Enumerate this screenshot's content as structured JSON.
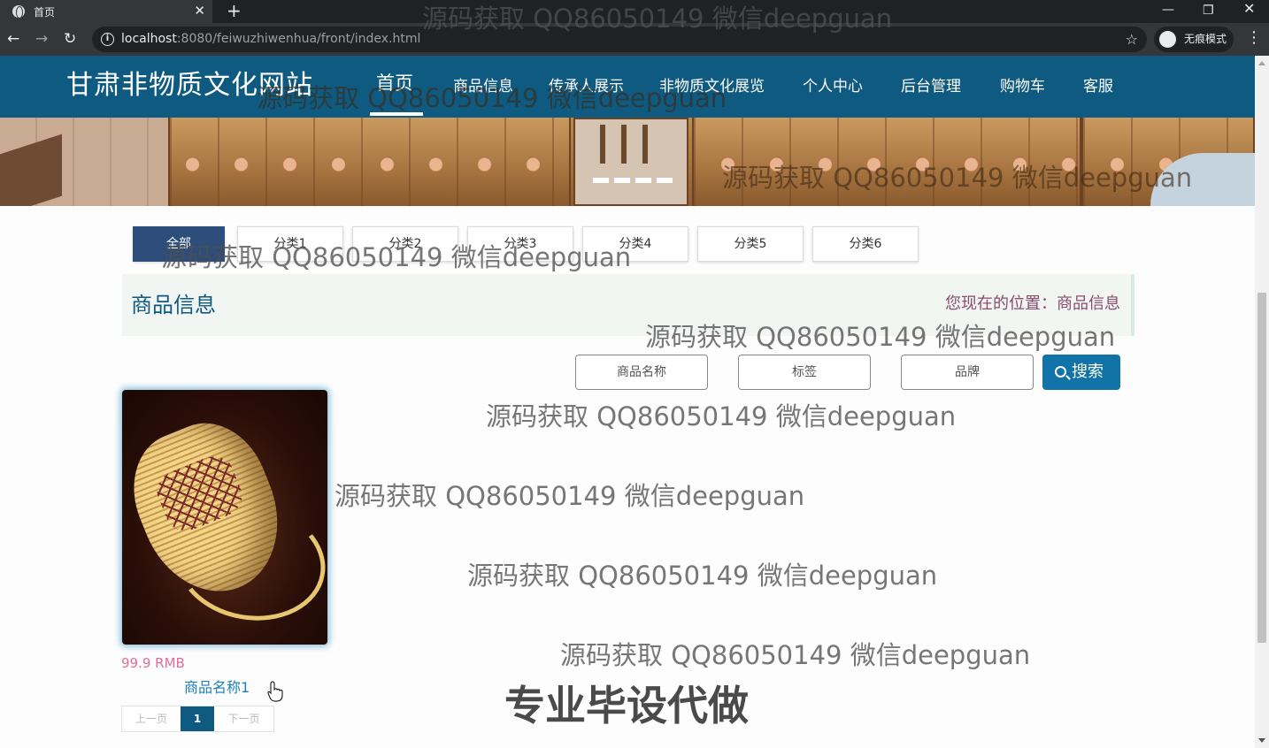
{
  "browser": {
    "tab_title": "首页",
    "tab_close": "✕",
    "new_tab": "+",
    "url_host": "localhost",
    "url_path": ":8080/feiwuzhiwenhua/front/index.html",
    "incognito_label": "无痕模式",
    "window_min": "—",
    "window_restore": "❐",
    "window_close": "✕",
    "back": "←",
    "forward": "→",
    "reload": "↻",
    "star": "☆",
    "menu": "⋮",
    "info": "i"
  },
  "site": {
    "title": "甘肃非物质文化网站",
    "nav": [
      "首页",
      "商品信息",
      "传承人展示",
      "非物质文化展览",
      "个人中心",
      "后台管理",
      "购物车",
      "客服"
    ],
    "active_nav": "首页"
  },
  "categories": [
    "全部",
    "分类1",
    "分类2",
    "分类3",
    "分类4",
    "分类5",
    "分类6"
  ],
  "breadcrumb": {
    "title": "商品信息",
    "prefix": "您现在的位置：",
    "current": "商品信息"
  },
  "search": {
    "name_placeholder": "商品名称",
    "tag_placeholder": "标签",
    "brand_placeholder": "品牌",
    "button_label": "搜索"
  },
  "products": [
    {
      "price": "99.9 RMB",
      "name": "商品名称1",
      "image": "woven-basket-image"
    }
  ],
  "pagination": {
    "prev": "上一页",
    "current": "1",
    "next": "下一页"
  },
  "watermarks": {
    "text": "源码获取 QQ86050149 微信deepguan",
    "promo": "专业毕设代做"
  },
  "colors": {
    "header_bg": "#0f5a80",
    "accent": "#1273a8",
    "active_category": "#2d4d7a",
    "price": "#e56a9a"
  }
}
